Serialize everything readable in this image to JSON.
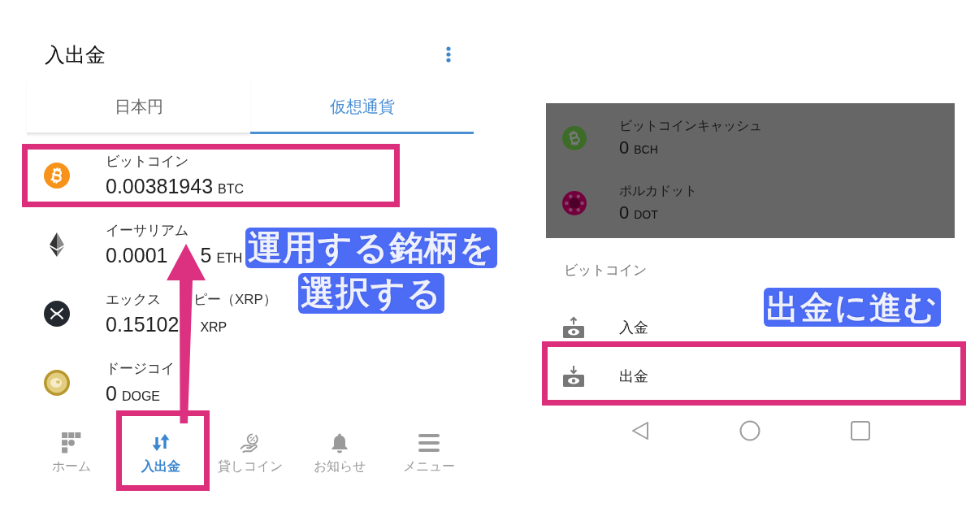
{
  "left_screen": {
    "title": "入出金",
    "tabs": [
      {
        "label": "日本円",
        "selected": false
      },
      {
        "label": "仮想通貨",
        "selected": true
      }
    ],
    "coins": [
      {
        "name": [
          {
            "kind": "text",
            "text": "ビットコイン"
          }
        ],
        "balance": [
          {
            "kind": "amount",
            "text": "0.00381943"
          },
          {
            "kind": "unit",
            "text": "BTC"
          }
        ],
        "highlighted": true
      },
      {
        "name": [
          {
            "kind": "text",
            "text": "イーサリアム"
          }
        ],
        "balance": [
          {
            "kind": "amount",
            "text": "0.0001"
          },
          {
            "kind": "covered"
          },
          {
            "kind": "covered"
          },
          {
            "kind": "amount",
            "text": "5"
          },
          {
            "kind": "unit",
            "text": "ETH"
          }
        ],
        "highlighted": false
      },
      {
        "name": [
          {
            "kind": "text",
            "text": "エックス"
          },
          {
            "kind": "covered"
          },
          {
            "kind": "covered"
          },
          {
            "kind": "text",
            "text": "ピー（XRP）"
          }
        ],
        "balance": [
          {
            "kind": "amount",
            "text": "0.15102"
          },
          {
            "kind": "covered"
          },
          {
            "kind": "unit",
            "text": "XRP"
          }
        ],
        "highlighted": false
      },
      {
        "name": [
          {
            "kind": "text",
            "text": "ドージコイ"
          }
        ],
        "balance": [
          {
            "kind": "amount",
            "text": "0"
          },
          {
            "kind": "unit",
            "text": "DOGE"
          }
        ],
        "highlighted": false
      }
    ],
    "nav": [
      {
        "label": "ホーム",
        "selected": false,
        "highlighted": false
      },
      {
        "label": "入出金",
        "selected": true,
        "highlighted": true
      },
      {
        "label": "貸しコイン",
        "selected": false,
        "highlighted": false
      },
      {
        "label": "お知らせ",
        "selected": false,
        "highlighted": false
      },
      {
        "label": "メニュー",
        "selected": false,
        "highlighted": false
      }
    ],
    "callout": {
      "lines": [
        "運用する銘柄を",
        "選択する"
      ]
    }
  },
  "right_screen": {
    "background_coins": {
      "dimmed": true,
      "items": [
        {
          "name": [
            {
              "kind": "text",
              "text": "ビットコインキャッシュ"
            }
          ],
          "balance": [
            {
              "kind": "amount",
              "text": "0"
            },
            {
              "kind": "unit",
              "text": "BCH"
            }
          ]
        },
        {
          "name": [
            {
              "kind": "text",
              "text": "ポルカドット"
            }
          ],
          "balance": [
            {
              "kind": "amount",
              "text": "0"
            },
            {
              "kind": "unit",
              "text": "DOT"
            }
          ]
        }
      ]
    },
    "sheet": {
      "title": "ビットコイン",
      "options": [
        {
          "label": "入金",
          "highlighted": false
        },
        {
          "label": "出金",
          "highlighted": true
        }
      ]
    },
    "callout": {
      "lines": [
        "出金に進む"
      ]
    }
  }
}
